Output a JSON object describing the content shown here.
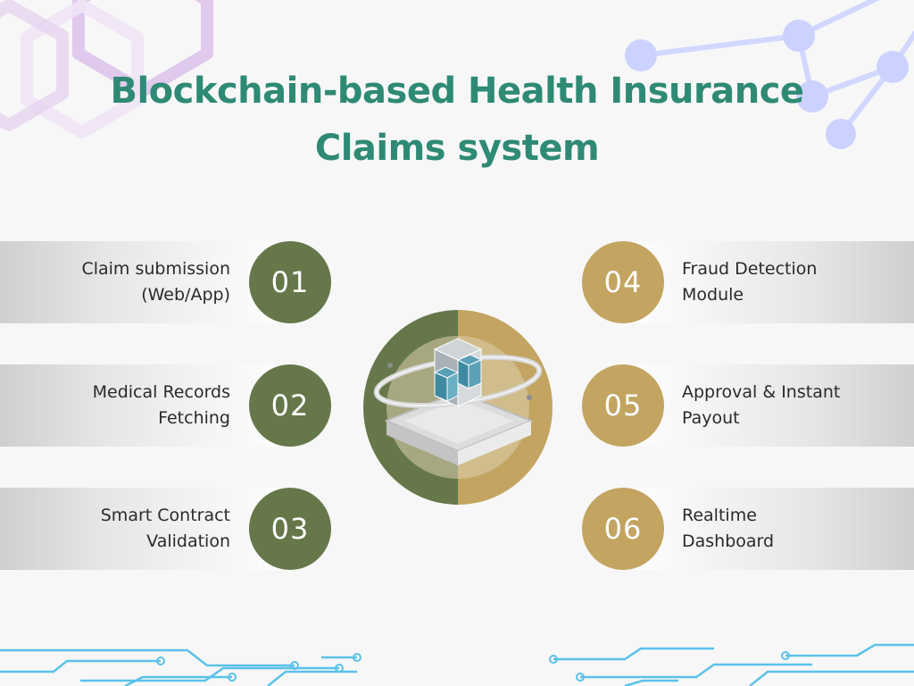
{
  "title": {
    "line1": "Blockchain-based Health Insurance",
    "line2": "Claims system"
  },
  "colors": {
    "title": "#2e8a74",
    "green": "#66774a",
    "gold": "#c3a461",
    "circuit": "#5bc2ea",
    "molecule": "#c9d0ff",
    "hexagon": "#d8b6e8"
  },
  "steps": [
    {
      "number": "01",
      "line1": "Claim submission",
      "line2": "(Web/App)"
    },
    {
      "number": "02",
      "line1": "Medical Records",
      "line2": "Fetching"
    },
    {
      "number": "03",
      "line1": "Smart Contract",
      "line2": "Validation"
    },
    {
      "number": "04",
      "line1": "Fraud Detection",
      "line2": "Module"
    },
    {
      "number": "05",
      "line1": "Approval & Instant",
      "line2": "Payout"
    },
    {
      "number": "06",
      "line1": "Realtime",
      "line2": "Dashboard"
    }
  ],
  "icons": {
    "center": "blockchain-cube-icon",
    "molecule": "molecule-network-icon",
    "hexagon": "hexagon-pattern-icon",
    "circuit": "circuit-lines-icon"
  }
}
